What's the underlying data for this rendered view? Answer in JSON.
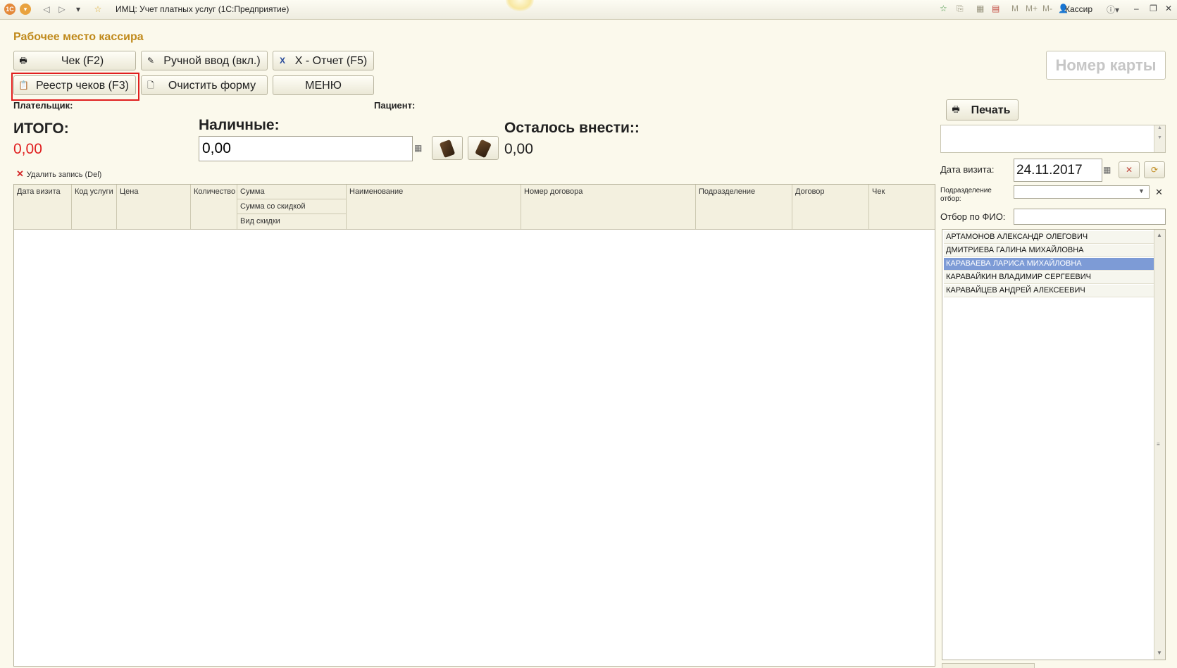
{
  "window": {
    "title": "ИМЦ: Учет платных услуг  (1С:Предприятие)",
    "user": "Кассир"
  },
  "page_title": "Рабочее место кассира",
  "toolbar": {
    "check": "Чек (F2)",
    "manual": "Ручной ввод (вкл.)",
    "xreport": "X - Отчет (F5)",
    "registry": "Реестр чеков (F3)",
    "clear": "Очистить форму",
    "menu": "МЕНЮ"
  },
  "payer_label": "Плательщик:",
  "patient_label": "Пациент:",
  "totals": {
    "total_label": "ИТОГО:",
    "total_value": "0,00",
    "cash_label": "Наличные:",
    "cash_value": "0,00",
    "remaining_label": "Осталось внести::",
    "remaining_value": "0,00"
  },
  "delete_label": "Удалить запись (Del)",
  "table": {
    "columns": {
      "visit_date": "Дата визита",
      "service_code": "Код услуги",
      "price": "Цена",
      "quantity": "Количество",
      "sum": "Сумма",
      "sum_discount": "Сумма со скидкой",
      "discount_type": "Вид скидки",
      "name": "Наименование",
      "contract_no": "Номер договора",
      "subdivision": "Подразделение",
      "contract": "Договор",
      "check": "Чек"
    }
  },
  "right": {
    "card_placeholder": "Номер карты",
    "print": "Печать",
    "visit_date_label": "Дата визита:",
    "visit_date": "24.11.2017",
    "subdivision_label_1": "Подразделение",
    "subdivision_label_2": "отбор:",
    "fio_label": "Отбор по ФИО:",
    "patients": [
      "АРТАМОНОВ АЛЕКСАНДР ОЛЕГОВИЧ",
      "ДМИТРИЕВА ГАЛИНА МИХАЙЛОВНА",
      "КАРАВАЕВА ЛАРИСА МИХАЙЛОВНА",
      "КАРАВАЙКИН ВЛАДИМИР СЕРГЕЕВИЧ",
      "КАРАВАЙЦЕВ АНДРЕЙ АЛЕКСЕЕВИЧ"
    ],
    "selected_patient_index": 2
  },
  "colors": {
    "accent_title": "#c08a1c",
    "total_red": "#e02020",
    "selection": "#7d9bd6",
    "highlight_box": "#e01e1e"
  }
}
